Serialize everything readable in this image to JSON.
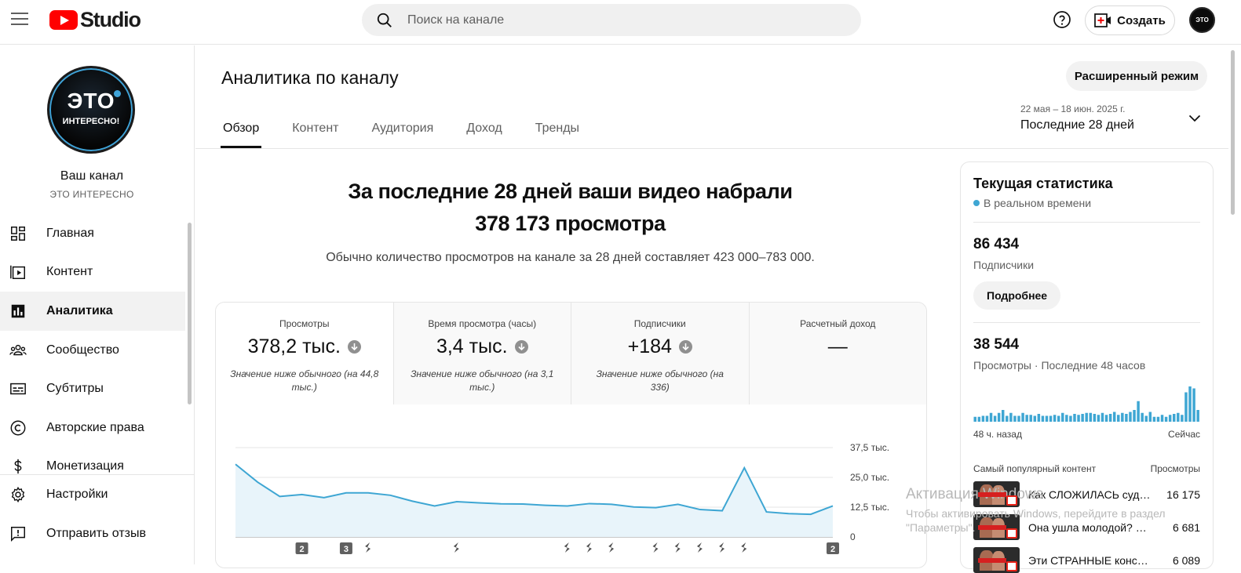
{
  "app": {
    "logo_text": "Studio"
  },
  "search": {
    "placeholder": "Поиск на канале"
  },
  "header": {
    "create_label": "Создать",
    "avatar_text": "ЭТО"
  },
  "channel": {
    "avatar_big": "ЭТО",
    "avatar_small": "ИНТЕРЕСНО!",
    "title": "Ваш канал",
    "name": "ЭТО ИНТЕРЕСНО"
  },
  "sidebar": {
    "items": [
      {
        "label": "Главная"
      },
      {
        "label": "Контент"
      },
      {
        "label": "Аналитика"
      },
      {
        "label": "Сообщество"
      },
      {
        "label": "Субтитры"
      },
      {
        "label": "Авторские права"
      },
      {
        "label": "Монетизация"
      }
    ],
    "bottom": [
      {
        "label": "Настройки"
      },
      {
        "label": "Отправить отзыв"
      }
    ]
  },
  "page": {
    "title": "Аналитика по каналу",
    "advanced_label": "Расширенный режим",
    "tabs": [
      {
        "label": "Обзор"
      },
      {
        "label": "Контент"
      },
      {
        "label": "Аудитория"
      },
      {
        "label": "Доход"
      },
      {
        "label": "Тренды"
      }
    ],
    "date_range": "22 мая – 18 июн. 2025 г.",
    "period": "Последние 28 дней",
    "headline_1": "За последние 28 дней ваши видео набрали",
    "headline_2": "378 173 просмотра",
    "subline": "Обычно количество просмотров на канале за 28 дней составляет 423 000–783 000."
  },
  "metrics": [
    {
      "label": "Просмотры",
      "value": "378,2 тыс.",
      "note": "Значение ниже обычного (на 44,8 тыс.)"
    },
    {
      "label": "Время просмотра (часы)",
      "value": "3,4 тыс.",
      "note": "Значение ниже обычного (на 3,1 тыс.)"
    },
    {
      "label": "Подписчики",
      "value": "+184",
      "note": "Значение ниже обычного (на 336)"
    },
    {
      "label": "Расчетный доход",
      "value": "—",
      "note": ""
    }
  ],
  "chart_data": {
    "type": "area",
    "series": [
      {
        "values": [
          30500,
          23000,
          17000,
          17800,
          16500,
          18500,
          18500,
          17500,
          15000,
          13000,
          14800,
          14300,
          13900,
          13800,
          13300,
          13000,
          14000,
          13700,
          12600,
          12300,
          13700,
          11500,
          11000,
          29000,
          10500,
          9800,
          9500,
          13000
        ]
      }
    ],
    "ylim": [
      0,
      37500
    ],
    "yticks": [
      "37,5 тыс.",
      "25,0 тыс.",
      "12,5 тыс.",
      "0"
    ],
    "yticks_values": [
      37500,
      25000,
      12500,
      0
    ],
    "markers": [
      {
        "index": 3,
        "label": "2"
      },
      {
        "index": 5,
        "label": "3"
      },
      {
        "index": 6,
        "label": ""
      },
      {
        "index": 10,
        "label": ""
      },
      {
        "index": 15,
        "label": ""
      },
      {
        "index": 16,
        "label": ""
      },
      {
        "index": 17,
        "label": ""
      },
      {
        "index": 19,
        "label": ""
      },
      {
        "index": 20,
        "label": ""
      },
      {
        "index": 21,
        "label": ""
      },
      {
        "index": 22,
        "label": ""
      },
      {
        "index": 23,
        "label": ""
      },
      {
        "index": 27,
        "label": "2"
      }
    ],
    "line_color": "#3ea6d3",
    "fill_color": "#e8f4fa",
    "grid": true
  },
  "realtime": {
    "title": "Текущая статистика",
    "live_label": "В реальном времени",
    "subscribers_value": "86 434",
    "subscribers_label": "Подписчики",
    "more_label": "Подробнее",
    "views_value": "38 544",
    "views_label": "Просмотры · Последние 48 часов",
    "axis_left": "48 ч. назад",
    "axis_right": "Сейчас",
    "bars": [
      5,
      5,
      6,
      6,
      9,
      6,
      9,
      12,
      6,
      9,
      6,
      6,
      9,
      7,
      7,
      6,
      8,
      6,
      6,
      6,
      7,
      6,
      9,
      7,
      6,
      8,
      7,
      8,
      9,
      9,
      8,
      7,
      9,
      7,
      8,
      10,
      7,
      9,
      8,
      10,
      12,
      21,
      9,
      6,
      10,
      5,
      5,
      7,
      5,
      7,
      8,
      9,
      7,
      30,
      36,
      34,
      12
    ],
    "bar_color": "#3ea6d3",
    "top_head_left": "Самый популярный контент",
    "top_head_right": "Просмотры",
    "top_items": [
      {
        "title": "Как СЛОЖИЛАСЬ судьба...",
        "views": "16 175"
      },
      {
        "title": "Она ушла молодой? Что...",
        "views": "6 681"
      },
      {
        "title": "Эти СТРАННЫЕ консерв...",
        "views": "6 089"
      }
    ]
  },
  "watermark": {
    "line1": "Активация Windows",
    "line2": "Чтобы активировать Windows, перейдите в раздел \"Параметры\"."
  }
}
